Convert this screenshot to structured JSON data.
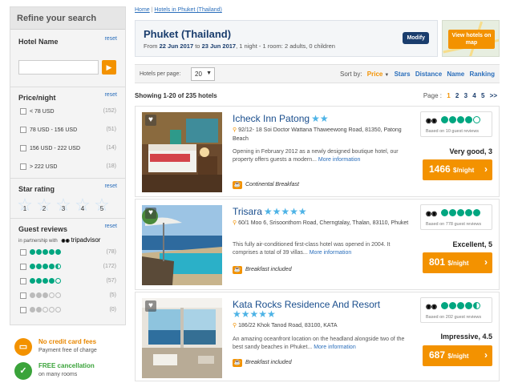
{
  "sidebar": {
    "title": "Refine your search",
    "hotel_name": {
      "label": "Hotel Name",
      "reset": "reset",
      "value": "",
      "placeholder": "",
      "go": "▶"
    },
    "price": {
      "label": "Price/night",
      "reset": "reset",
      "options": [
        {
          "label": "< 78 USD",
          "count": "(152)"
        },
        {
          "label": "78 USD - 156 USD",
          "count": "(51)"
        },
        {
          "label": "156 USD - 222 USD",
          "count": "(14)"
        },
        {
          "label": "> 222 USD",
          "count": "(18)"
        }
      ]
    },
    "stars": {
      "label": "Star rating",
      "reset": "reset",
      "options": [
        "1",
        "2",
        "3",
        "4",
        "5"
      ]
    },
    "reviews": {
      "label": "Guest reviews",
      "reset": "reset",
      "partner_text": "in partnership with",
      "partner_brand": "tripadvisor",
      "options": [
        {
          "rating": 5,
          "count": "(78)"
        },
        {
          "rating": 4.5,
          "count": "(172)"
        },
        {
          "rating": 4,
          "count": "(57)"
        },
        {
          "rating": 3,
          "count": "(5)"
        },
        {
          "rating": 2,
          "count": "(0)"
        }
      ]
    }
  },
  "features": [
    {
      "icon": "credit-card-icon",
      "glyph": "▭",
      "color": "#f39200",
      "title": "No credit card fees",
      "subtitle": "Payment free of charge"
    },
    {
      "icon": "checkmark-icon",
      "glyph": "✓",
      "color": "#3aa33a",
      "title": "FREE cancellation",
      "subtitle": "on many rooms"
    }
  ],
  "breadcrumb": {
    "home": "Home",
    "sep": "|",
    "current": "Hotels in Phuket (Thailand)"
  },
  "search_summary": {
    "city": "Phuket (Thailand)",
    "from_label": "From",
    "from_date": "22 Jun 2017",
    "to_label": "to",
    "to_date": "23 Jun 2017",
    "details": ", 1 night - 1 room: 2 adults, 0 children",
    "modify": "Modify"
  },
  "map_button": "View hotels on map",
  "toolbar": {
    "per_page_label": "Hotels per page:",
    "per_page_value": "20",
    "sort_label": "Sort by:",
    "sort_active": "Price",
    "sort_options": [
      "Stars",
      "Distance",
      "Name",
      "Ranking"
    ]
  },
  "results": {
    "showing": "Showing 1-20 of 235 hotels",
    "page_label": "Page :",
    "pages": [
      "1",
      "2",
      "3",
      "4",
      "5",
      ">>"
    ],
    "current_page": "1"
  },
  "hotels": [
    {
      "name": "Icheck Inn Patong",
      "stars": "★★",
      "address": "92/12- 18 Soi Doctor Wattana Thaweewong Road, 81350, Patong Beach",
      "description": "Opening in February 2012 as a newly designed boutique hotel, our property offers guests a modern...",
      "more": "More information",
      "meal": "Continental Breakfast",
      "rating": 4,
      "reviews": "Based on 10 guest reviews",
      "verdict": "Very good, 3",
      "price": "1466",
      "price_unit": "$/night",
      "chevron": "›"
    },
    {
      "name": "Trisara",
      "stars": "★★★★★",
      "address": "60/1 Moo 6, Srisoonthorn Road, Cherngtalay, Thalan, 83110, Phuket",
      "description": "This fully air-conditioned first-class hotel was opened in 2004. It comprises a total of 39 villas...",
      "more": "More information",
      "meal": "Breakfast included",
      "rating": 5,
      "reviews": "Based on 778 guest reviews",
      "verdict": "Excellent, 5",
      "price": "801",
      "price_unit": "$/night",
      "chevron": "›"
    },
    {
      "name": "Kata Rocks Residence And Resort",
      "stars": "★★★★★",
      "address": "186/22 Khok Tanod Road, 83100, KATA",
      "description": "An amazing oceanfront location on the headland alongside two of the best sandy beaches in Phuket...",
      "more": "More information",
      "meal": "Breakfast included",
      "rating": 4.5,
      "reviews": "Based on 202 guest reviews",
      "verdict": "Impressive, 4.5",
      "price": "687",
      "price_unit": "$/night",
      "chevron": "›"
    }
  ],
  "colors": {
    "accent": "#f39200",
    "navy": "#1a3d6d",
    "link": "#2a6ebb",
    "tripadvisor": "#00a680"
  }
}
